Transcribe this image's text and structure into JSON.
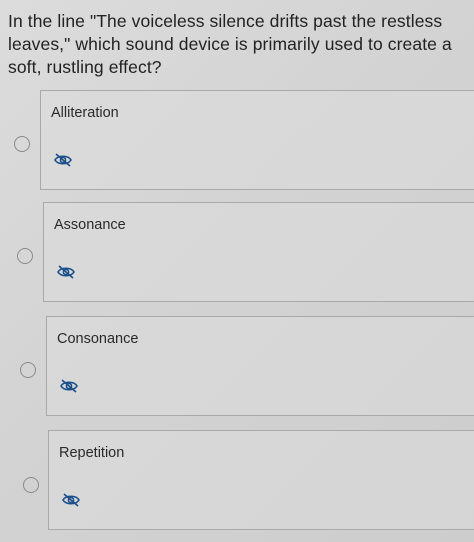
{
  "question": {
    "text": "In the line \"The voiceless silence drifts past the restless leaves,\" which sound device is primarily used to create a soft, rustling effect?"
  },
  "options": [
    {
      "label": "Alliteration",
      "icon": "eye-slash-icon"
    },
    {
      "label": "Assonance",
      "icon": "eye-slash-icon"
    },
    {
      "label": "Consonance",
      "icon": "eye-slash-icon"
    },
    {
      "label": "Repetition",
      "icon": "eye-slash-icon"
    }
  ],
  "colors": {
    "icon": "#1a4f8a",
    "border": "#a9a9a9",
    "background": "#d5d5d5"
  }
}
